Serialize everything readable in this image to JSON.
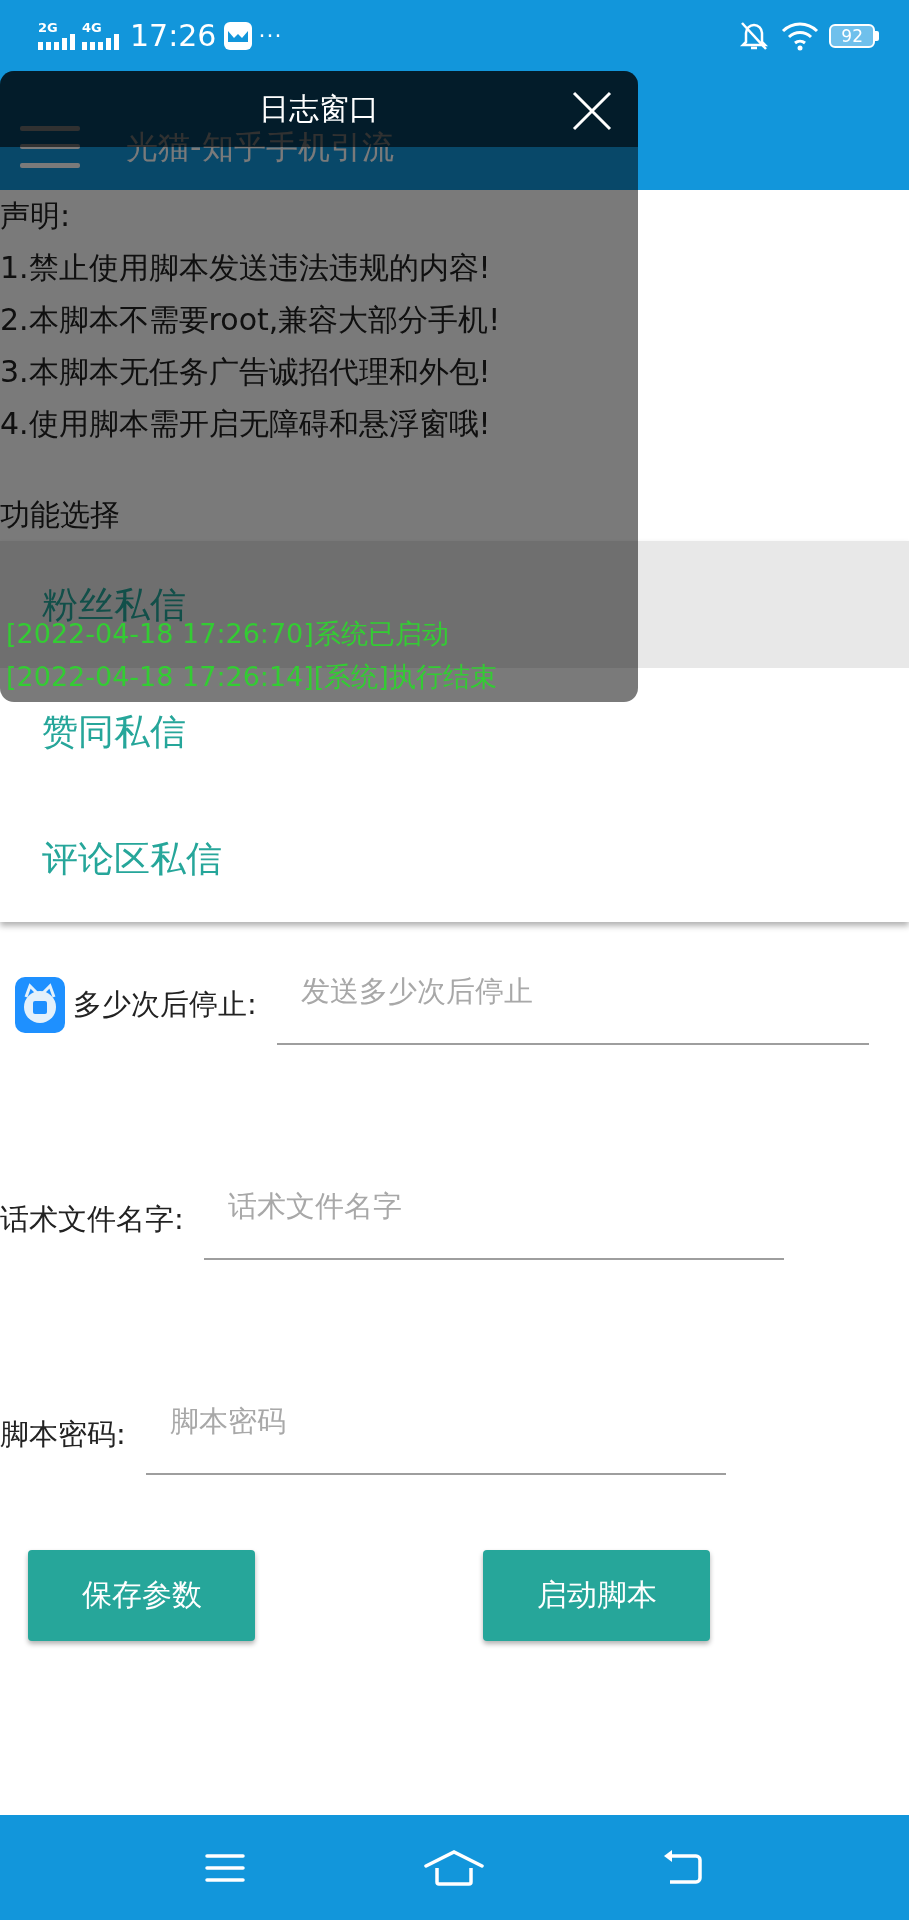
{
  "status_bar": {
    "network_1": "2G",
    "network_2": "4G",
    "time": "17:26",
    "more": "···",
    "battery": "92"
  },
  "app_bar": {
    "title": "光猫-知乎手机引流"
  },
  "notice": {
    "heading": "声明:",
    "lines": [
      "1.禁止使用脚本发送违法违规的内容!",
      "2.本脚本不需要root,兼容大部分手机!",
      "3.本脚本无任务广告诚招代理和外包!",
      "4.使用脚本需开启无障碍和悬浮窗哦!"
    ]
  },
  "section_label": "功能选择",
  "function_menu": {
    "items": [
      {
        "label": "粉丝私信",
        "selected": true
      },
      {
        "label": "赞同私信",
        "selected": false
      },
      {
        "label": "评论区私信",
        "selected": false
      }
    ]
  },
  "form": {
    "fields": [
      {
        "kind": "with_icon",
        "label": "多少次后停止:",
        "placeholder": "发送多少次后停止"
      },
      {
        "kind": "plain",
        "label": "话术文件名字:",
        "placeholder": "话术文件名字"
      },
      {
        "kind": "plain",
        "label": "脚本密码:",
        "placeholder": "脚本密码"
      }
    ]
  },
  "buttons": [
    "保存参数",
    "启动脚本"
  ],
  "log_window": {
    "title": "日志窗口",
    "lines": [
      "[2022-04-18 17:26:70]系统已启动",
      "[2022-04-18 17:26:14][系统]执行结束"
    ]
  }
}
